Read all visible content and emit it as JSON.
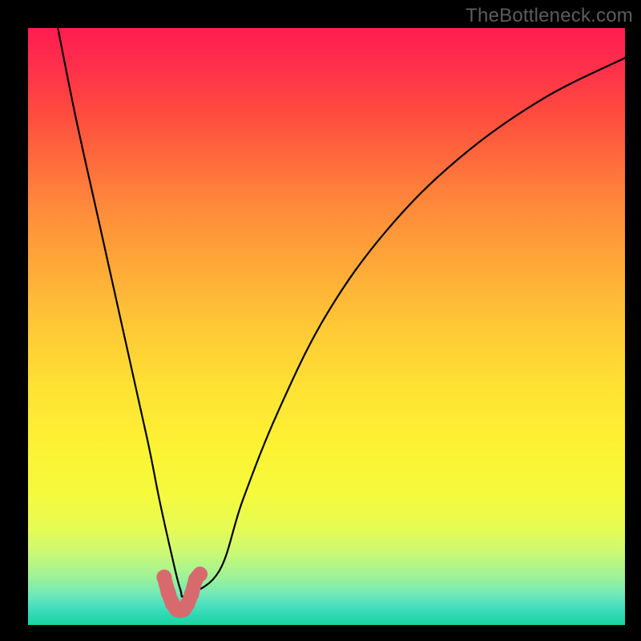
{
  "watermark": "TheBottleneck.com",
  "chart_data": {
    "type": "line",
    "title": "",
    "xlabel": "",
    "ylabel": "",
    "xlim": [
      0,
      100
    ],
    "ylim": [
      0,
      100
    ],
    "series": [
      {
        "name": "black-curve",
        "x": [
          5,
          8,
          12,
          16,
          20,
          22,
          24,
          25.5,
          26.5,
          32,
          36,
          42,
          50,
          60,
          72,
          86,
          100
        ],
        "y": [
          100,
          85,
          67,
          49,
          31,
          21,
          12,
          6,
          5,
          9,
          21,
          36,
          52,
          66,
          78,
          88,
          95
        ],
        "color": "#000000"
      },
      {
        "name": "pink-highlight",
        "x": [
          22.8,
          23.5,
          24.2,
          24.9,
          25.5,
          26.1,
          26.7,
          27.4,
          28.1,
          28.8
        ],
        "y": [
          8.0,
          5.4,
          3.6,
          2.6,
          2.4,
          2.6,
          3.5,
          5.2,
          7.6,
          8.5
        ],
        "color": "#d86a6d"
      }
    ],
    "gradient_colors": {
      "top": "#ff1c52",
      "mid": "#ffe134",
      "bottom": "#18d6a2"
    }
  }
}
